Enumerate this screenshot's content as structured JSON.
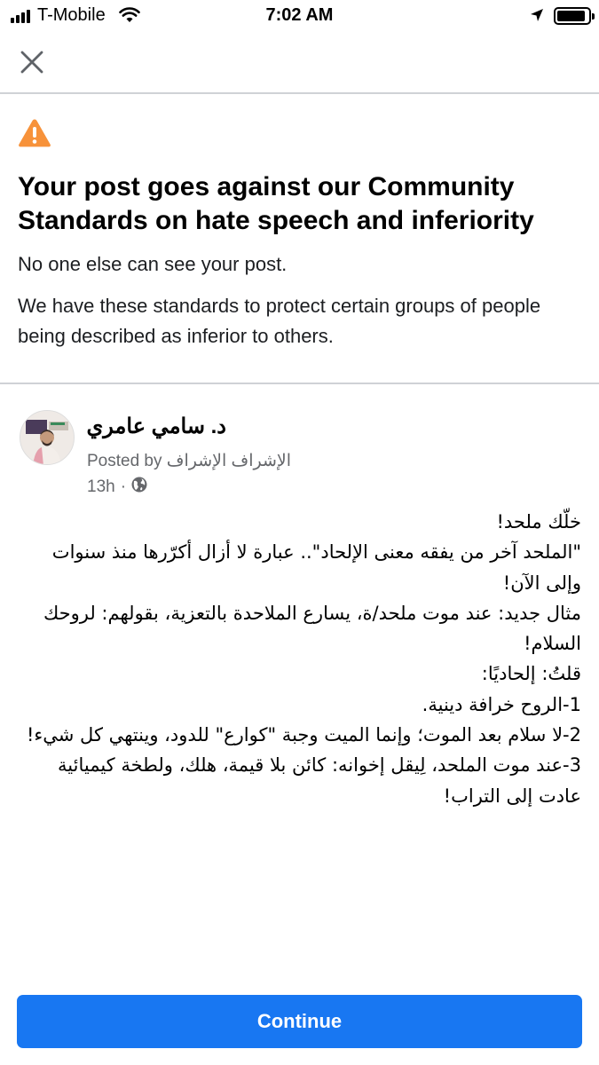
{
  "status_bar": {
    "carrier": "T-Mobile",
    "time": "7:02 AM",
    "signal_icon": "signal-bars-icon",
    "wifi_icon": "wifi-icon",
    "location_icon": "location-arrow-icon",
    "battery_icon": "battery-icon",
    "battery_level": 0.9
  },
  "header": {
    "close_icon": "close-icon"
  },
  "notice": {
    "icon": "warning-triangle-icon",
    "icon_color": "#f7923a",
    "title": "Your post goes against our Community Standards on hate speech and inferiority",
    "subtitle": "No one else can see your post.",
    "explanation": "We have these standards to protect certain groups of people being described as inferior to others."
  },
  "post": {
    "author": "د. سامي عامري",
    "posted_by": "Posted by الإشراف الإشراف",
    "time": "13h",
    "separator": "·",
    "privacy_icon": "globe-icon",
    "lines": [
      "خلّك ملحد!",
      "\"الملحد آخر من يفقه معنى الإلحاد\".. عبارة لا أزال أكرّرها منذ سنوات وإلى الآن!",
      "مثال جديد: عند موت ملحد/ة، يسارع الملاحدة بالتعزية، بقولهم: لروحك السلام!",
      "قلتُ: إلحاديًا:",
      "1-الروح خرافة دينية.",
      "2-لا سلام بعد الموت؛ وإنما الميت وجبة \"كوارع\" للدود، وينتهي كل شيء!",
      "3-عند موت الملحد، لِيقل إخوانه: كائن بلا قيمة، هلك، ولطخة كيميائية عادت إلى التراب!"
    ]
  },
  "actions": {
    "continue_label": "Continue",
    "accent_color": "#1877f2"
  }
}
